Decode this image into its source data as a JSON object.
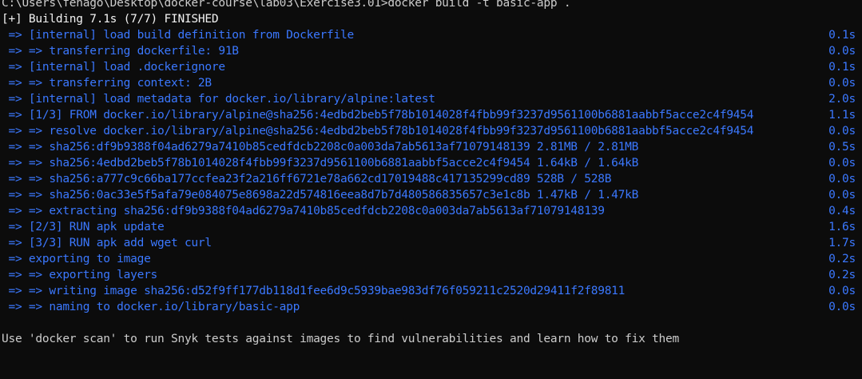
{
  "terminal": {
    "colors": {
      "background": "#0c0c0c",
      "foreground": "#cccccc",
      "step": "#3b78ff",
      "status": "#f2f2f2"
    },
    "prompt_line": "C:\\Users\\fenago\\Desktop\\docker-course\\lab03\\Exercise3.01>docker build -t basic-app .",
    "status_line": "[+] Building 7.1s (7/7) FINISHED",
    "steps": [
      {
        "text": " => [internal] load build definition from Dockerfile",
        "time": "0.1s"
      },
      {
        "text": " => => transferring dockerfile: 91B",
        "time": "0.0s"
      },
      {
        "text": " => [internal] load .dockerignore",
        "time": "0.1s"
      },
      {
        "text": " => => transferring context: 2B",
        "time": "0.0s"
      },
      {
        "text": " => [internal] load metadata for docker.io/library/alpine:latest",
        "time": "2.0s"
      },
      {
        "text": " => [1/3] FROM docker.io/library/alpine@sha256:4edbd2beb5f78b1014028f4fbb99f3237d9561100b6881aabbf5acce2c4f9454",
        "time": "1.1s"
      },
      {
        "text": " => => resolve docker.io/library/alpine@sha256:4edbd2beb5f78b1014028f4fbb99f3237d9561100b6881aabbf5acce2c4f9454",
        "time": "0.0s"
      },
      {
        "text": " => => sha256:df9b9388f04ad6279a7410b85cedfdcb2208c0a003da7ab5613af71079148139 2.81MB / 2.81MB",
        "time": "0.5s"
      },
      {
        "text": " => => sha256:4edbd2beb5f78b1014028f4fbb99f3237d9561100b6881aabbf5acce2c4f9454 1.64kB / 1.64kB",
        "time": "0.0s"
      },
      {
        "text": " => => sha256:a777c9c66ba177ccfea23f2a216ff6721e78a662cd17019488c417135299cd89 528B / 528B",
        "time": "0.0s"
      },
      {
        "text": " => => sha256:0ac33e5f5afa79e084075e8698a22d574816eea8d7b7d480586835657c3e1c8b 1.47kB / 1.47kB",
        "time": "0.0s"
      },
      {
        "text": " => => extracting sha256:df9b9388f04ad6279a7410b85cedfdcb2208c0a003da7ab5613af71079148139",
        "time": "0.4s"
      },
      {
        "text": " => [2/3] RUN apk update",
        "time": "1.6s"
      },
      {
        "text": " => [3/3] RUN apk add wget curl",
        "time": "1.7s"
      },
      {
        "text": " => exporting to image",
        "time": "0.2s"
      },
      {
        "text": " => => exporting layers",
        "time": "0.2s"
      },
      {
        "text": " => => writing image sha256:d52f9ff177db118d1fee6d9c5939bae983df76f059211c2520d29411f2f89811",
        "time": "0.0s"
      },
      {
        "text": " => => naming to docker.io/library/basic-app",
        "time": "0.0s"
      }
    ],
    "footer_line": "Use 'docker scan' to run Snyk tests against images to find vulnerabilities and learn how to fix them"
  }
}
